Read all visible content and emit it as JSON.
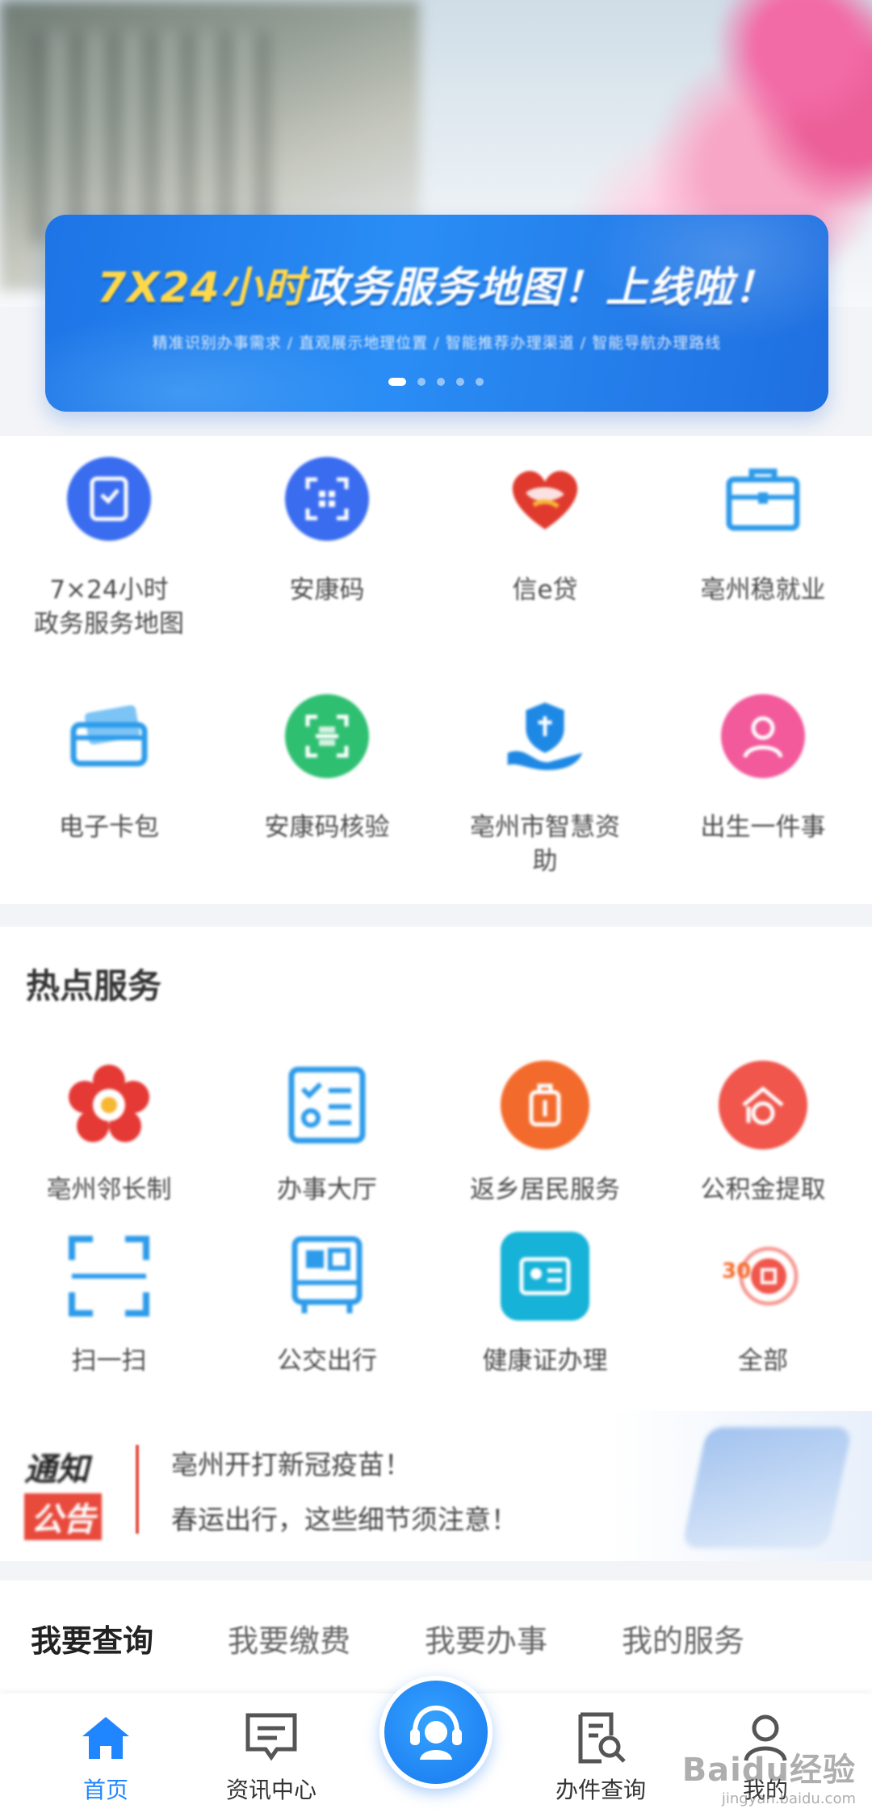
{
  "banner": {
    "title_accent": "7X24小时",
    "title_rest": "政务服务地图！上线啦！",
    "subtitle": "精准识别办事需求 / 直观展示地理位置 / 智能推荐办理渠道 / 智能导航办理路线"
  },
  "quick_services": [
    {
      "label": "7×24小时\n政务服务地图",
      "icon": "map-doc-icon",
      "color": "#3a6cf0"
    },
    {
      "label": "安康码",
      "icon": "qr-code-icon",
      "color": "#3a6cf0"
    },
    {
      "label": "信e贷",
      "icon": "heart-hands-icon",
      "color": "#e03a2e"
    },
    {
      "label": "亳州稳就业",
      "icon": "briefcase-icon",
      "color": "#2d9bea"
    },
    {
      "label": "电子卡包",
      "icon": "card-wallet-icon",
      "color": "#2d9bea"
    },
    {
      "label": "安康码核验",
      "icon": "qr-verify-icon",
      "color": "#2fbf71"
    },
    {
      "label": "亳州市智慧资\n助",
      "icon": "shield-hand-icon",
      "color": "#1e88e5"
    },
    {
      "label": "出生一件事",
      "icon": "person-icon",
      "color": "#f25a9c"
    }
  ],
  "hot": {
    "title": "热点服务",
    "items": [
      {
        "label": "亳州邻长制",
        "icon": "flower-emblem-icon",
        "color": "#e53935"
      },
      {
        "label": "办事大厅",
        "icon": "checklist-icon",
        "color": "#2d9bea"
      },
      {
        "label": "返乡居民服务",
        "icon": "luggage-icon",
        "color": "#f36b2c"
      },
      {
        "label": "公积金提取",
        "icon": "house-coin-icon",
        "color": "#f0564c"
      },
      {
        "label": "扫一扫",
        "icon": "scan-icon",
        "color": "#2d9bea"
      },
      {
        "label": "公交出行",
        "icon": "bus-icon",
        "color": "#2d9bea"
      },
      {
        "label": "健康证办理",
        "icon": "id-card-icon",
        "color": "#16b2d8"
      },
      {
        "label": "全部",
        "icon": "all-apps-icon",
        "color": "#f0564c"
      }
    ]
  },
  "notice": {
    "badge_top": "通知",
    "badge_bottom": "公告",
    "lines": [
      "亳州开打新冠疫苗！",
      "春运出行，这些细节须注意！"
    ]
  },
  "tabs": [
    "我要查询",
    "我要缴费",
    "我要办事",
    "我的服务"
  ],
  "bottom_nav": [
    {
      "label": "首页",
      "icon": "home-icon",
      "active": true
    },
    {
      "label": "资讯中心",
      "icon": "message-icon",
      "active": false
    },
    {
      "label": "",
      "icon": "customer-service-icon",
      "active": false
    },
    {
      "label": "办件查询",
      "icon": "doc-search-icon",
      "active": false
    },
    {
      "label": "我的",
      "icon": "user-icon",
      "active": false
    }
  ],
  "watermark": {
    "line1": "Baidu经验",
    "line2": "jingyan.baidu.com"
  },
  "colors": {
    "primary": "#1f86ff",
    "banner": "#2a8df5",
    "accent": "#ffd84a"
  }
}
